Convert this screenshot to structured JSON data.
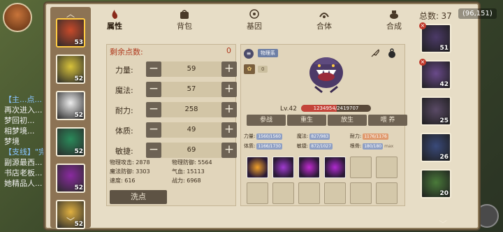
{
  "tabs": [
    {
      "label": "属性",
      "icon": "flame-icon",
      "active": true
    },
    {
      "label": "背包",
      "icon": "bag-icon",
      "active": false
    },
    {
      "label": "基因",
      "icon": "gene-icon",
      "active": false
    },
    {
      "label": "合体",
      "icon": "merge-icon",
      "active": false
    },
    {
      "label": "合成",
      "icon": "pot-icon",
      "active": false
    }
  ],
  "total": {
    "label": "总数:",
    "value": "37"
  },
  "coords": "(96,151)",
  "background_text": {
    "lines": [
      "【主...点...",
      "再次进入...",
      "梦回初...",
      "相梦境...",
      "梦境",
      "【支线】\"完",
      "副源最西...",
      "书店老板...",
      "她精品人..."
    ]
  },
  "team": [
    {
      "level": "53"
    },
    {
      "level": "52"
    },
    {
      "level": "52"
    },
    {
      "level": "52"
    },
    {
      "level": "52"
    },
    {
      "level": "52"
    }
  ],
  "attributes": {
    "points_label": "剩余点数:",
    "points_value": "0",
    "rows": [
      {
        "name": "力量:",
        "value": "59"
      },
      {
        "name": "魔法:",
        "value": "57"
      },
      {
        "name": "耐力:",
        "value": "258"
      },
      {
        "name": "体质:",
        "value": "49"
      },
      {
        "name": "敏捷:",
        "value": "69"
      }
    ],
    "derived": [
      [
        "物理攻击: 2878",
        "物理防御: 5564"
      ],
      [
        "魔法防御: 3303",
        "气血: 15113"
      ],
      [
        "速度: 616",
        "战力: 6968"
      ]
    ],
    "reset_label": "洗点"
  },
  "hero": {
    "job_badge": "物理系",
    "food_value": "0",
    "level": "Lv.42",
    "exp_text": "1234954/2419707",
    "exp_fraction": 0.51,
    "actions": [
      "参战",
      "重生",
      "放生",
      "喂 养"
    ],
    "stats": [
      [
        {
          "label": "力量:",
          "val": "1560/1560",
          "red": false
        },
        {
          "label": "魔法:",
          "val": "827/983",
          "red": false
        },
        {
          "label": "耐力:",
          "val": "1176/1176",
          "red": true
        }
      ],
      [
        {
          "label": "体质:",
          "val": "1166/1730",
          "red": false
        },
        {
          "label": "敏捷:",
          "val": "872/1027",
          "red": false
        },
        {
          "label": "根骨:",
          "val": "180/180",
          "red": false,
          "suffix": "max"
        }
      ]
    ],
    "skills_filled": 4,
    "skills_total": 12
  },
  "right_strip": [
    {
      "level": "51"
    },
    {
      "level": "42"
    },
    {
      "level": "25"
    },
    {
      "level": "26"
    },
    {
      "level": "20"
    }
  ],
  "colors": {
    "accent_red": "#b03b1f",
    "exp_red": "#c4443a",
    "panel": "#e1d5bb"
  }
}
